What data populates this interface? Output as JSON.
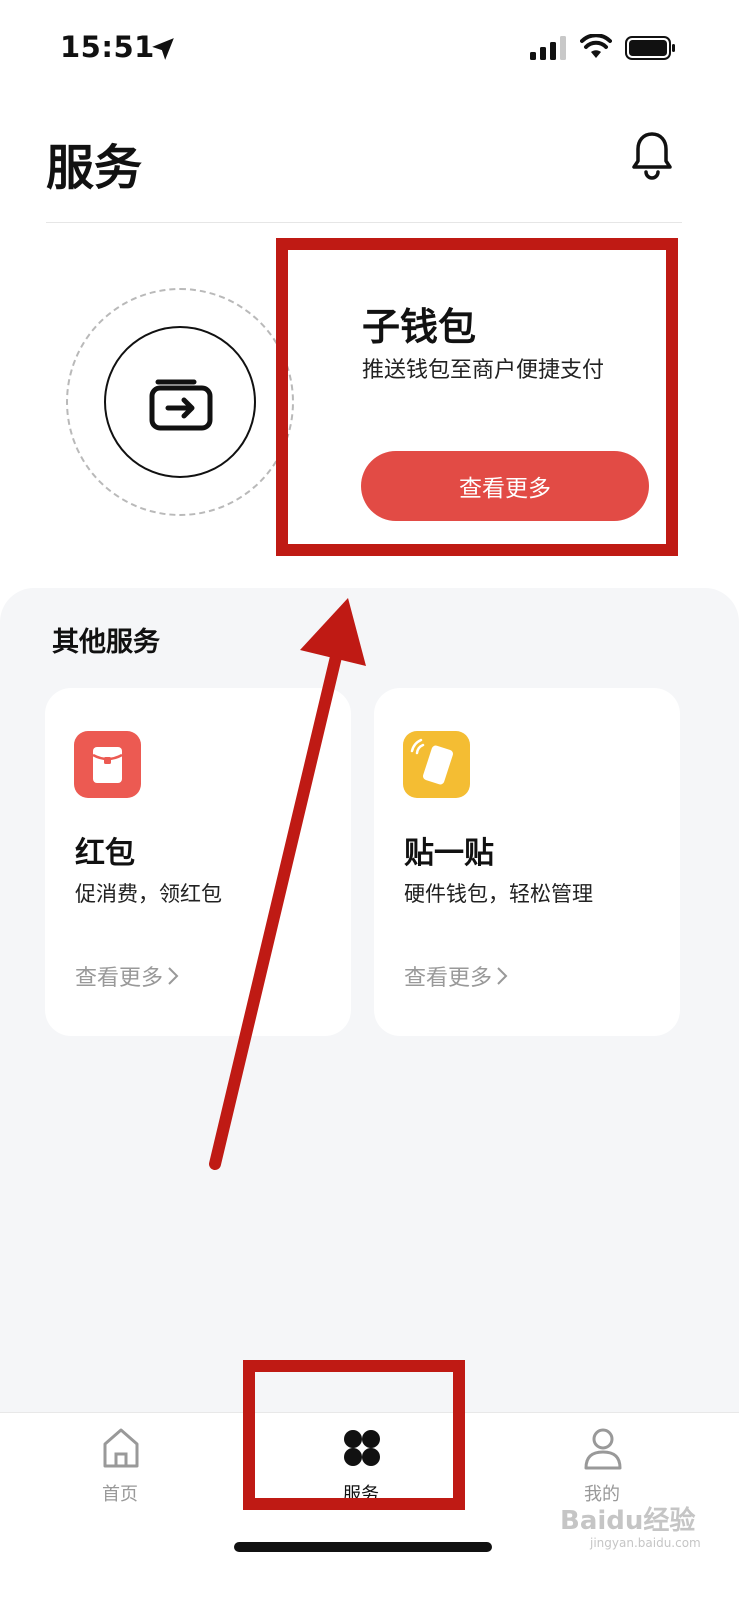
{
  "status_bar": {
    "time": "15:51"
  },
  "header": {
    "title": "服务"
  },
  "hero": {
    "title": "子钱包",
    "subtitle": "推送钱包至商户便捷支付",
    "button_label": "查看更多"
  },
  "other_services": {
    "title": "其他服务",
    "cards": [
      {
        "title": "红包",
        "desc": "促消费，领红包",
        "link": "查看更多",
        "icon": "red-envelope-icon",
        "color": "#ec5a52"
      },
      {
        "title": "贴一贴",
        "desc": "硬件钱包，轻松管理",
        "link": "查看更多",
        "icon": "tap-card-icon",
        "color": "#f4bd33"
      }
    ]
  },
  "bottom_nav": {
    "items": [
      {
        "label": "首页",
        "icon": "home-icon",
        "active": false
      },
      {
        "label": "服务",
        "icon": "grid-icon",
        "active": true
      },
      {
        "label": "我的",
        "icon": "user-icon",
        "active": false
      }
    ]
  },
  "watermark": {
    "text": "Baidu经验",
    "sub": "jingyan.baidu.com"
  },
  "colors": {
    "accent": "#e24b45",
    "annotation": "#bf1a14",
    "panel_bg": "#f5f6f8"
  }
}
